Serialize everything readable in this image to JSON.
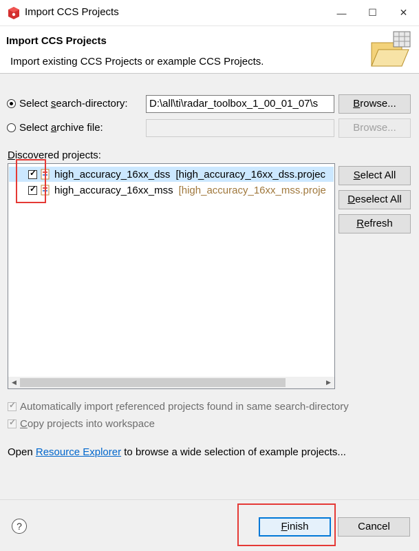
{
  "window": {
    "title": "Import CCS Projects",
    "minimize": "—",
    "maximize": "☐",
    "close": "✕"
  },
  "banner": {
    "title": "Import CCS Projects",
    "description": "Import existing CCS Projects or example CCS Projects."
  },
  "search": {
    "dir_label_pre": "Select ",
    "dir_label_u": "s",
    "dir_label_post": "earch-directory:",
    "dir_value": "D:\\all\\ti\\radar_toolbox_1_00_01_07\\s",
    "dir_selected": true,
    "archive_label_pre": "Select ",
    "archive_label_u": "a",
    "archive_label_post": "rchive file:",
    "archive_value": "",
    "browse_pre": "",
    "browse_u": "B",
    "browse_post": "rowse...",
    "browse2_label": "Browse..."
  },
  "projects": {
    "label_u": "D",
    "label_post": "iscovered projects:",
    "items": [
      {
        "name": "high_accuracy_16xx_dss",
        "path": "[high_accuracy_16xx_dss.projec",
        "checked": true,
        "selected": true
      },
      {
        "name": "high_accuracy_16xx_mss",
        "path": "[high_accuracy_16xx_mss.proje",
        "checked": true,
        "selected": false
      }
    ],
    "scroll_left": "◀",
    "scroll_right": "▶"
  },
  "side_buttons": {
    "select_all_u": "S",
    "select_all_post": "elect All",
    "deselect_all_u": "D",
    "deselect_all_post": "eselect All",
    "refresh_u": "R",
    "refresh_post": "efresh"
  },
  "options": {
    "auto_import_pre": "Automatically import ",
    "auto_import_u": "r",
    "auto_import_post": "eferenced projects found in same search-directory",
    "copy_u": "C",
    "copy_post": "opy projects into workspace"
  },
  "explorer": {
    "pre": "Open ",
    "link": "Resource Explorer",
    "post": " to browse a wide selection of example projects..."
  },
  "footer": {
    "help": "?",
    "finish_u": "F",
    "finish_post": "inish",
    "cancel": "Cancel"
  },
  "colors": {
    "highlight": "#e53935",
    "selection": "#cce8ff",
    "link": "#0066cc"
  }
}
